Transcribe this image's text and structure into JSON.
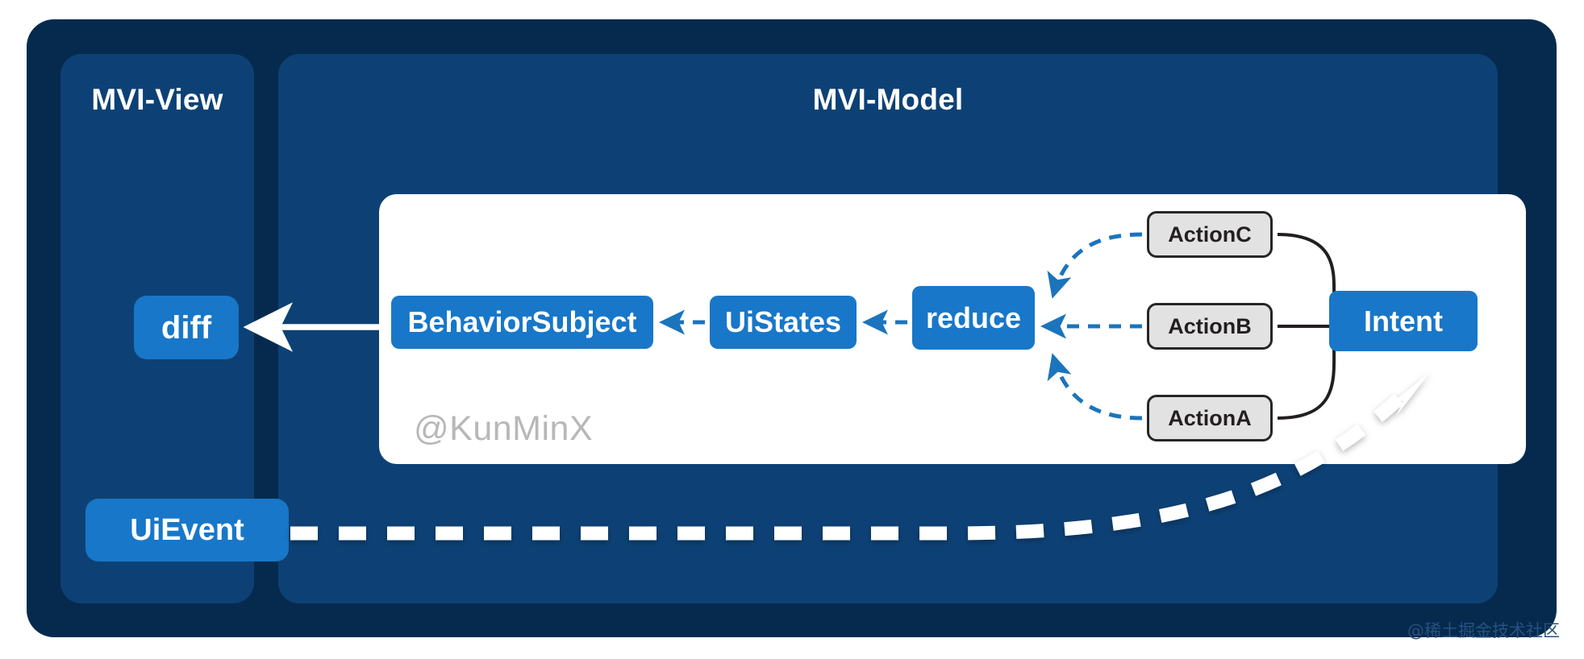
{
  "diagram": {
    "type": "flow-diagram",
    "title_left": "MVI-View",
    "title_right": "MVI-Model",
    "board_watermark": "@KunMinX",
    "corner_watermark": "@稀土掘金技术社区",
    "colors": {
      "page_background": "#ffffff",
      "outer_card": "#062A4E",
      "panel": "#0D4175",
      "board": "#ffffff",
      "node_blue": "#1877C8",
      "node_gray_fill": "#E2E2E2",
      "node_gray_border": "#262626",
      "arrow_dashed_blue": "#1B74BC",
      "arrow_solid_white": "#ffffff",
      "arrow_solid_black": "#231F20",
      "watermark_gray": "#b8b8b8"
    },
    "nodes": [
      {
        "id": "diff",
        "label": "diff",
        "style": "blue",
        "panel": "MVI-View"
      },
      {
        "id": "uievent",
        "label": "UiEvent",
        "style": "blue",
        "panel": "MVI-View"
      },
      {
        "id": "behaviorsubject",
        "label": "BehaviorSubject",
        "style": "blue",
        "panel": "MVI-Model"
      },
      {
        "id": "uistates",
        "label": "UiStates",
        "style": "blue",
        "panel": "MVI-Model"
      },
      {
        "id": "reduce",
        "label": "reduce",
        "style": "blue",
        "panel": "MVI-Model"
      },
      {
        "id": "actionC",
        "label": "ActionC",
        "style": "gray",
        "panel": "MVI-Model"
      },
      {
        "id": "actionB",
        "label": "ActionB",
        "style": "gray",
        "panel": "MVI-Model"
      },
      {
        "id": "actionA",
        "label": "ActionA",
        "style": "gray",
        "panel": "MVI-Model"
      },
      {
        "id": "intent",
        "label": "Intent",
        "style": "blue",
        "panel": "MVI-Model"
      }
    ],
    "edges": [
      {
        "from": "behaviorsubject",
        "to": "diff",
        "style": "solid-white-arrow"
      },
      {
        "from": "uistates",
        "to": "behaviorsubject",
        "style": "dashed-blue-arrow"
      },
      {
        "from": "reduce",
        "to": "uistates",
        "style": "dashed-blue-arrow"
      },
      {
        "from": "actionC",
        "to": "reduce",
        "style": "dashed-blue-curve-arrow"
      },
      {
        "from": "actionB",
        "to": "reduce",
        "style": "dashed-blue-arrow"
      },
      {
        "from": "actionA",
        "to": "reduce",
        "style": "dashed-blue-curve-arrow"
      },
      {
        "from": "intent",
        "to": "actionC",
        "style": "solid-black-curve"
      },
      {
        "from": "intent",
        "to": "actionB",
        "style": "solid-black-line"
      },
      {
        "from": "intent",
        "to": "actionA",
        "style": "solid-black-curve"
      },
      {
        "from": "uievent",
        "to": "intent",
        "style": "dashed-white-thick-arrow"
      }
    ]
  }
}
